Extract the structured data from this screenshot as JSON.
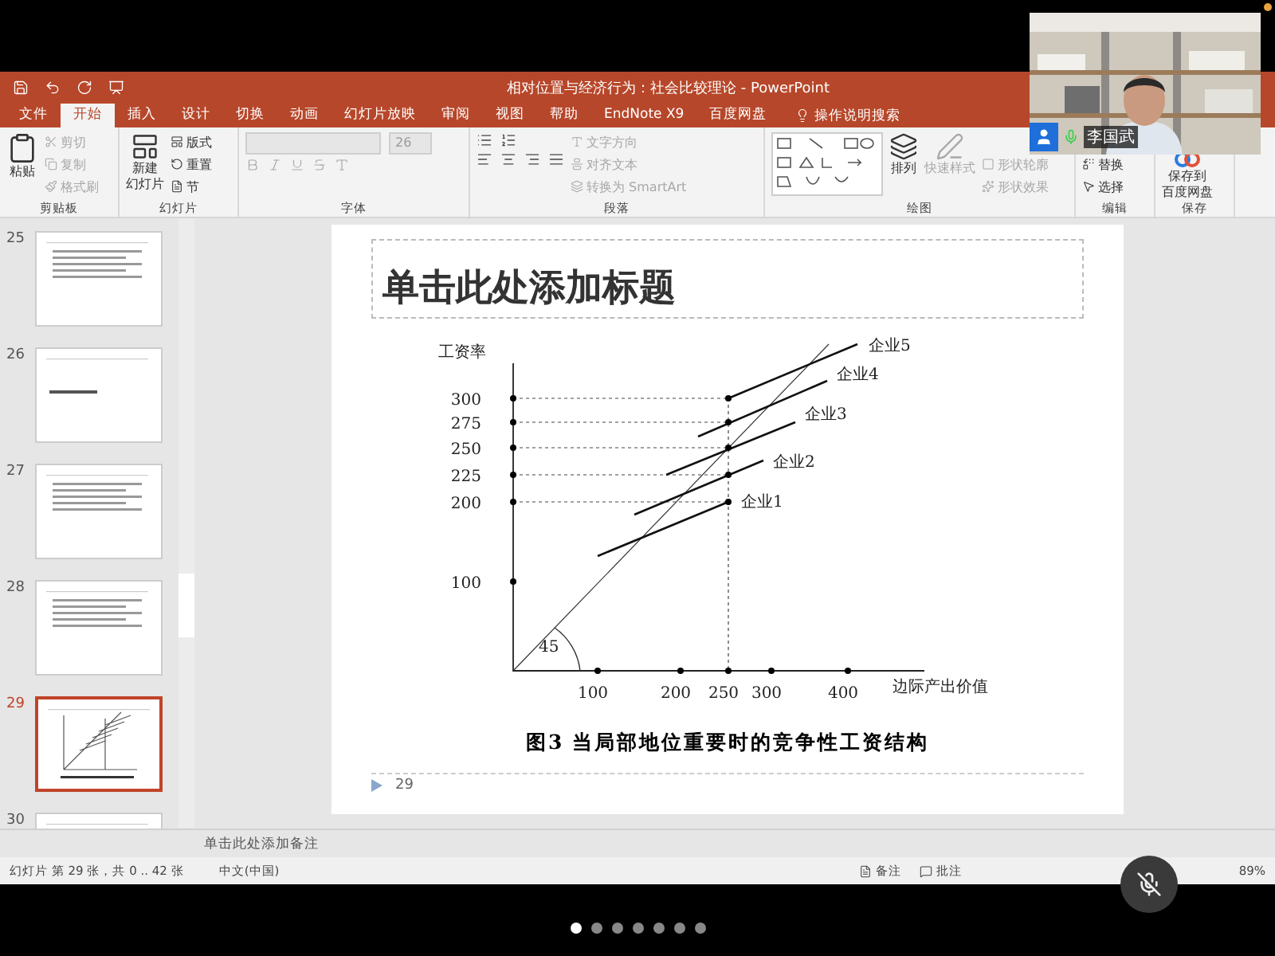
{
  "window": {
    "title": "相对位置与经济行为：社会比较理论 - PowerPoint"
  },
  "tabs": [
    {
      "label": "文件",
      "selected": false
    },
    {
      "label": "开始",
      "selected": true
    },
    {
      "label": "插入",
      "selected": false
    },
    {
      "label": "设计",
      "selected": false
    },
    {
      "label": "切换",
      "selected": false
    },
    {
      "label": "动画",
      "selected": false
    },
    {
      "label": "幻灯片放映",
      "selected": false
    },
    {
      "label": "审阅",
      "selected": false
    },
    {
      "label": "视图",
      "selected": false
    },
    {
      "label": "帮助",
      "selected": false
    },
    {
      "label": "EndNote X9",
      "selected": false
    },
    {
      "label": "百度网盘",
      "selected": false
    }
  ],
  "tell_me": "操作说明搜索",
  "ribbon": {
    "clipboard": {
      "label": "剪贴板",
      "paste": {
        "label": "粘贴",
        "disabled": false
      },
      "cut": {
        "label": "剪切",
        "disabled": true
      },
      "copy": {
        "label": "复制",
        "disabled": true
      },
      "format_painter": {
        "label": "格式刷",
        "disabled": true
      }
    },
    "slides": {
      "label": "幻灯片",
      "new_slide": {
        "lines": [
          "新建",
          "幻灯片"
        ],
        "disabled": false
      },
      "layout": {
        "label": "版式",
        "disabled": false
      },
      "reset": {
        "label": "重置",
        "disabled": false
      },
      "section": {
        "label": "节",
        "disabled": false
      }
    },
    "font": {
      "label": "字体",
      "size": "26",
      "disabled": true
    },
    "paragraph": {
      "label": "段落",
      "text_direction": {
        "label": "文字方向",
        "disabled": true
      },
      "align_text": {
        "label": "对齐文本",
        "disabled": true
      },
      "smartart": {
        "label": "转换为 SmartArt",
        "disabled": true
      }
    },
    "drawing": {
      "label": "绘图",
      "arrange": {
        "label": "排列",
        "disabled": false
      },
      "quick_styles": {
        "label": "快速样式",
        "disabled": true
      },
      "shape_outline": {
        "label": "形状轮廓",
        "disabled": true
      },
      "shape_effects": {
        "label": "形状效果",
        "disabled": true
      }
    },
    "editing": {
      "label": "编辑",
      "replace": {
        "label": "替换",
        "disabled": false
      },
      "select": {
        "label": "选择",
        "disabled": false
      }
    },
    "save": {
      "label": "保存",
      "baidu": {
        "lines": [
          "保存到",
          "百度网盘"
        ],
        "disabled": false
      }
    }
  },
  "thumbnails": [
    {
      "number": "25",
      "selected": false,
      "kind": "text"
    },
    {
      "number": "26",
      "selected": false,
      "kind": "heading"
    },
    {
      "number": "27",
      "selected": false,
      "kind": "text"
    },
    {
      "number": "28",
      "selected": false,
      "kind": "text"
    },
    {
      "number": "29",
      "selected": true,
      "kind": "chart"
    },
    {
      "number": "30",
      "selected": false,
      "kind": "text"
    }
  ],
  "slide": {
    "title_placeholder": "单击此处添加标题",
    "figure": {
      "y_label": "工资率",
      "x_label": "边际产出价值",
      "y_ticks": [
        "300",
        "275",
        "250",
        "225",
        "200",
        "100"
      ],
      "x_ticks": [
        "100",
        "200",
        "250",
        "300",
        "400"
      ],
      "angle_label": "45",
      "firms": [
        "企业1",
        "企业2",
        "企业3",
        "企业4",
        "企业5"
      ]
    },
    "caption": "图3 当局部地位重要时的竞争性工资结构",
    "page_number": "29"
  },
  "notes_placeholder": "单击此处添加备注",
  "status_bar": {
    "slide_info": "幻灯片 第 29 张，共 0 .. 42 张",
    "language": "中文(中国)",
    "notes": "备注",
    "comments": "批注",
    "zoom": "89%"
  },
  "video": {
    "participant": "李国武"
  },
  "page_dots": [
    {
      "selected": true
    },
    {
      "selected": false
    },
    {
      "selected": false
    },
    {
      "selected": false
    },
    {
      "selected": false
    },
    {
      "selected": false
    },
    {
      "selected": false
    }
  ]
}
